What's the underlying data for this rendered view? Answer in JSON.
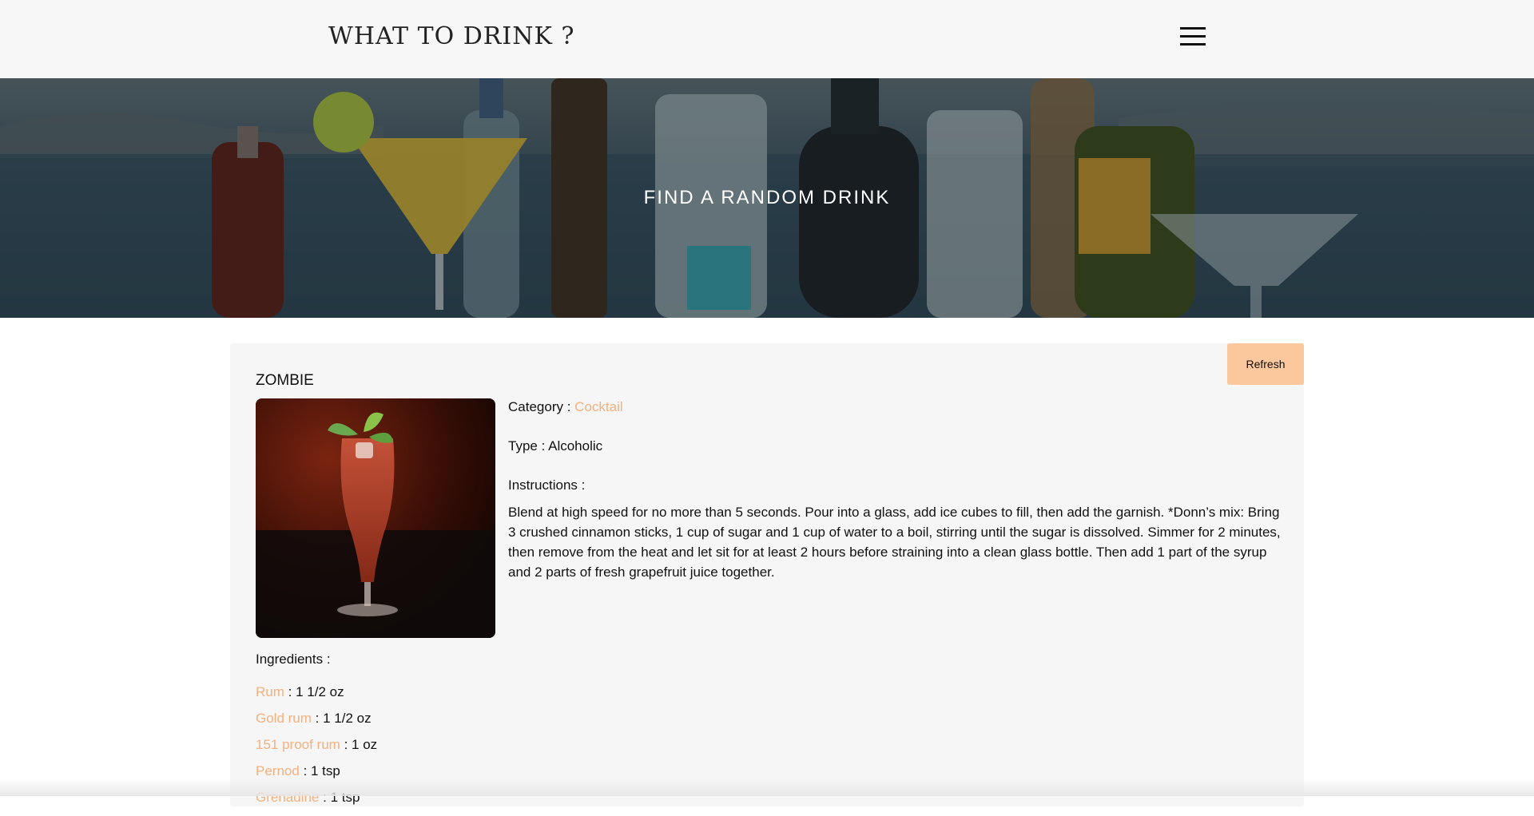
{
  "header": {
    "logo": "WHAT TO DRINK ?",
    "menu_icon": "hamburger-menu-icon"
  },
  "hero": {
    "title": "FIND A RANDOM DRINK"
  },
  "drink": {
    "refresh_label": "Refresh",
    "name": "ZOMBIE",
    "category_label": "Category :",
    "category": "Cocktail",
    "type_label": "Type :",
    "type": "Alcoholic",
    "instructions_label": "Instructions :",
    "instructions": "Blend at high speed for no more than 5 seconds. Pour into a glass, add ice cubes to fill, then add the garnish. *Donn’s mix: Bring 3 crushed cinnamon sticks, 1 cup of sugar and 1 cup of water to a boil, stirring until the sugar is dissolved. Simmer for 2 minutes, then remove from the heat and let sit for at least 2 hours before straining into a clean glass bottle. Then add 1 part of the syrup and 2 parts of fresh grapefruit juice together.",
    "ingredients_label": "Ingredients :",
    "ingredients": [
      {
        "name": "Rum",
        "measure": ": 1 1/2 oz"
      },
      {
        "name": "Gold rum",
        "measure": ": 1 1/2 oz"
      },
      {
        "name": "151 proof rum",
        "measure": ": 1 oz"
      },
      {
        "name": "Pernod",
        "measure": ": 1 tsp"
      },
      {
        "name": "Grenadine",
        "measure": ": 1 tsp"
      }
    ]
  },
  "colors": {
    "accent": "#f5b07d",
    "button": "#fbc79c",
    "header_bg": "#f7f7f7",
    "card_bg": "#f6f6f6"
  }
}
